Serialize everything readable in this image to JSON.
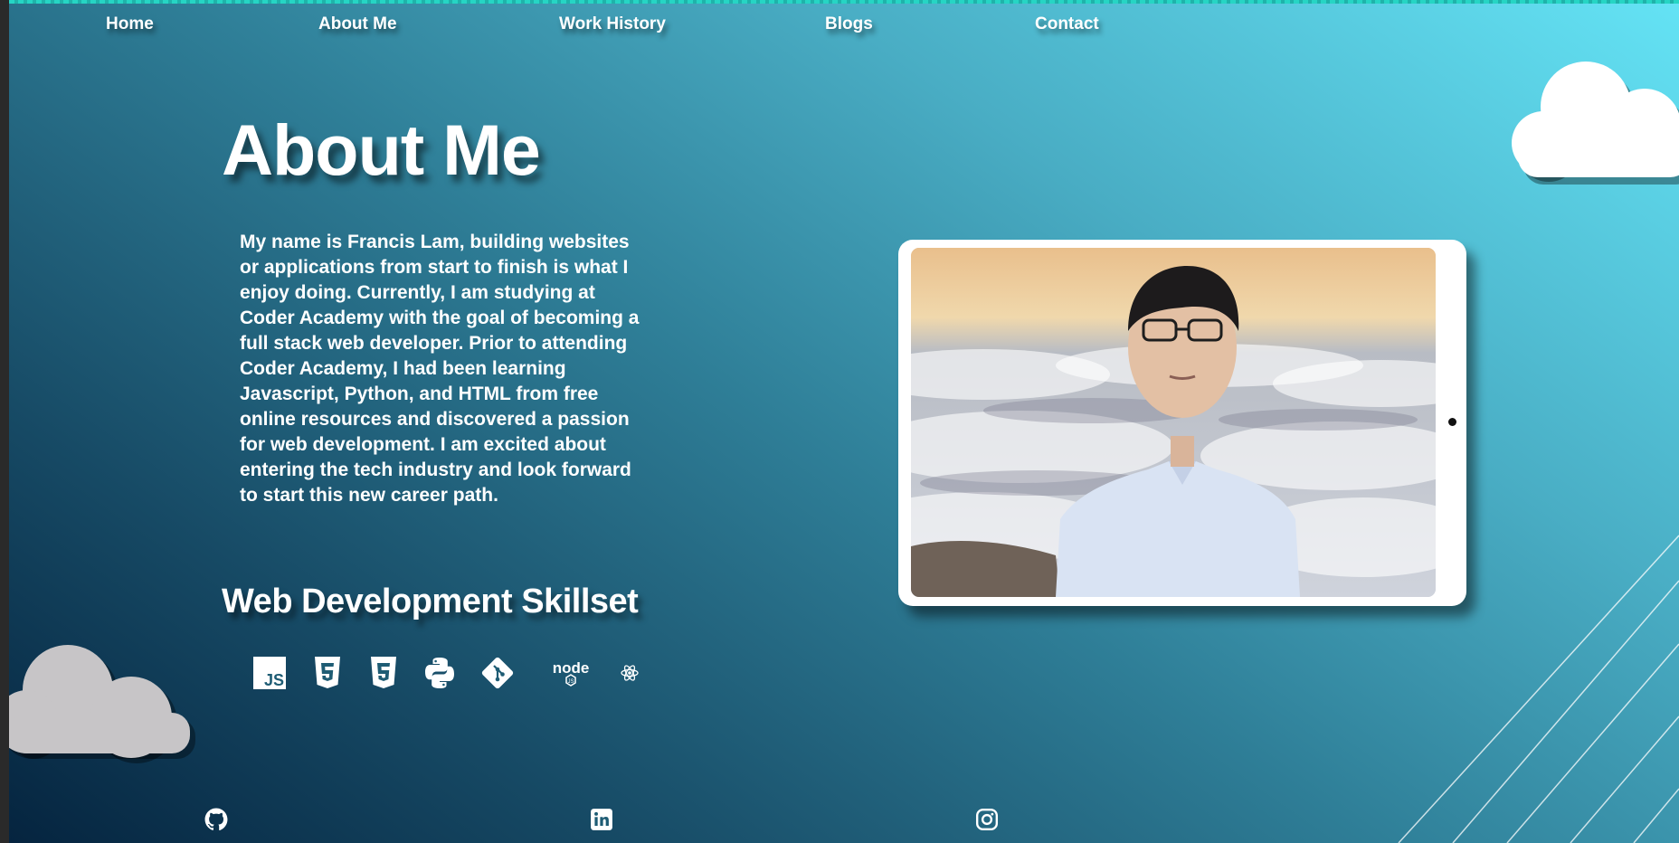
{
  "nav": {
    "items": [
      "Home",
      "About Me",
      "Work History",
      "Blogs",
      "Contact"
    ]
  },
  "page_title": "About Me",
  "bio": "My name is Francis Lam, building websites or applications from start to finish is what I enjoy doing. Currently, I am studying at Coder Academy with the goal of becoming a full stack web developer. Prior to attending Coder Academy, I had been learning Javascript, Python, and HTML from free online resources and discovered a passion for web development. I am excited about entering the tech industry and look forward to start this new career path.",
  "skills": {
    "heading": "Web Development Skillset",
    "icons": [
      "javascript-icon",
      "html5-icon",
      "css3-icon",
      "python-icon",
      "git-icon",
      "nodejs-icon",
      "react-icon"
    ],
    "js_text": "JS",
    "node_text": "node"
  },
  "socials": [
    "github-icon",
    "linkedin-icon",
    "instagram-icon"
  ],
  "colors": {
    "text": "#ffffff",
    "background_start": "#05243f",
    "background_end": "#64e3f5",
    "cloud": "#c7c5c7",
    "accent_stripe": "#26d5c4"
  }
}
